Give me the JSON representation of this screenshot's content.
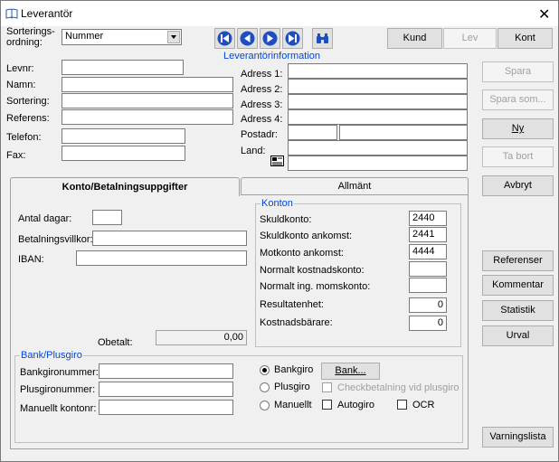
{
  "window": {
    "title": "Leverantör",
    "close_symbol": "✕"
  },
  "sort": {
    "label_line1": "Sorterings-",
    "label_line2": "ordning:",
    "value": "Nummer"
  },
  "toolbar": {
    "kund": "Kund",
    "lev": "Lev",
    "kont": "Kont"
  },
  "info_group": {
    "title": "Leverantörinformation"
  },
  "left_fields": [
    {
      "label": "Levnr:",
      "value": ""
    },
    {
      "label": "Namn:",
      "value": ""
    },
    {
      "label": "Sortering:",
      "value": ""
    },
    {
      "label": "Referens:",
      "value": ""
    },
    {
      "label": "Telefon:",
      "value": ""
    },
    {
      "label": "Fax:",
      "value": ""
    }
  ],
  "address_fields": [
    {
      "label": "Adress 1:",
      "value": ""
    },
    {
      "label": "Adress 2:",
      "value": ""
    },
    {
      "label": "Adress 3:",
      "value": ""
    },
    {
      "label": "Adress 4:",
      "value": ""
    }
  ],
  "postadr": {
    "label": "Postadr:",
    "zip": "",
    "city": ""
  },
  "land": {
    "label": "Land:",
    "value": "",
    "extra": ""
  },
  "actions": {
    "spara": "Spara",
    "spara_som": "Spara som...",
    "ny": "Ny",
    "ta_bort": "Ta bort",
    "avbryt": "Avbryt",
    "referenser": "Referenser",
    "kommentar": "Kommentar",
    "statistik": "Statistik",
    "urval": "Urval",
    "varningslista": "Varningslista"
  },
  "tabs": {
    "konto": "Konto/Betalningsuppgifter",
    "allmant": "Allmänt"
  },
  "payment": {
    "antal_dagar_label": "Antal dagar:",
    "antal_dagar": "",
    "villkor_label": "Betalningsvillkor:",
    "villkor": "",
    "iban_label": "IBAN:",
    "iban": "",
    "obetalt_label": "Obetalt:",
    "obetalt": "0,00"
  },
  "konton": {
    "title": "Konton",
    "rows": [
      {
        "label": "Skuldkonto:",
        "value": "2440"
      },
      {
        "label": "Skuldkonto ankomst:",
        "value": "2441"
      },
      {
        "label": "Motkonto ankomst:",
        "value": "4444"
      },
      {
        "label": "Normalt kostnadskonto:",
        "value": ""
      },
      {
        "label": "Normalt ing. momskonto:",
        "value": ""
      },
      {
        "label": "Resultatenhet:",
        "value": "0"
      },
      {
        "label": "Kostnadsbärare:",
        "value": "0"
      }
    ]
  },
  "bank": {
    "title": "Bank/Plusgiro",
    "bankgiro_label": "Bankgironummer:",
    "bankgiro": "",
    "plusgiro_label": "Plusgironummer:",
    "plusgiro": "",
    "manuellt_label": "Manuellt kontonr:",
    "manuellt": "",
    "radio_bankgiro": "Bankgiro",
    "radio_plusgiro": "Plusgiro",
    "radio_manuellt": "Manuellt",
    "bank_button": "Bank...",
    "check_plusgiro": "Checkbetalning vid plusgiro",
    "check_autogiro": "Autogiro",
    "check_ocr": "OCR"
  }
}
